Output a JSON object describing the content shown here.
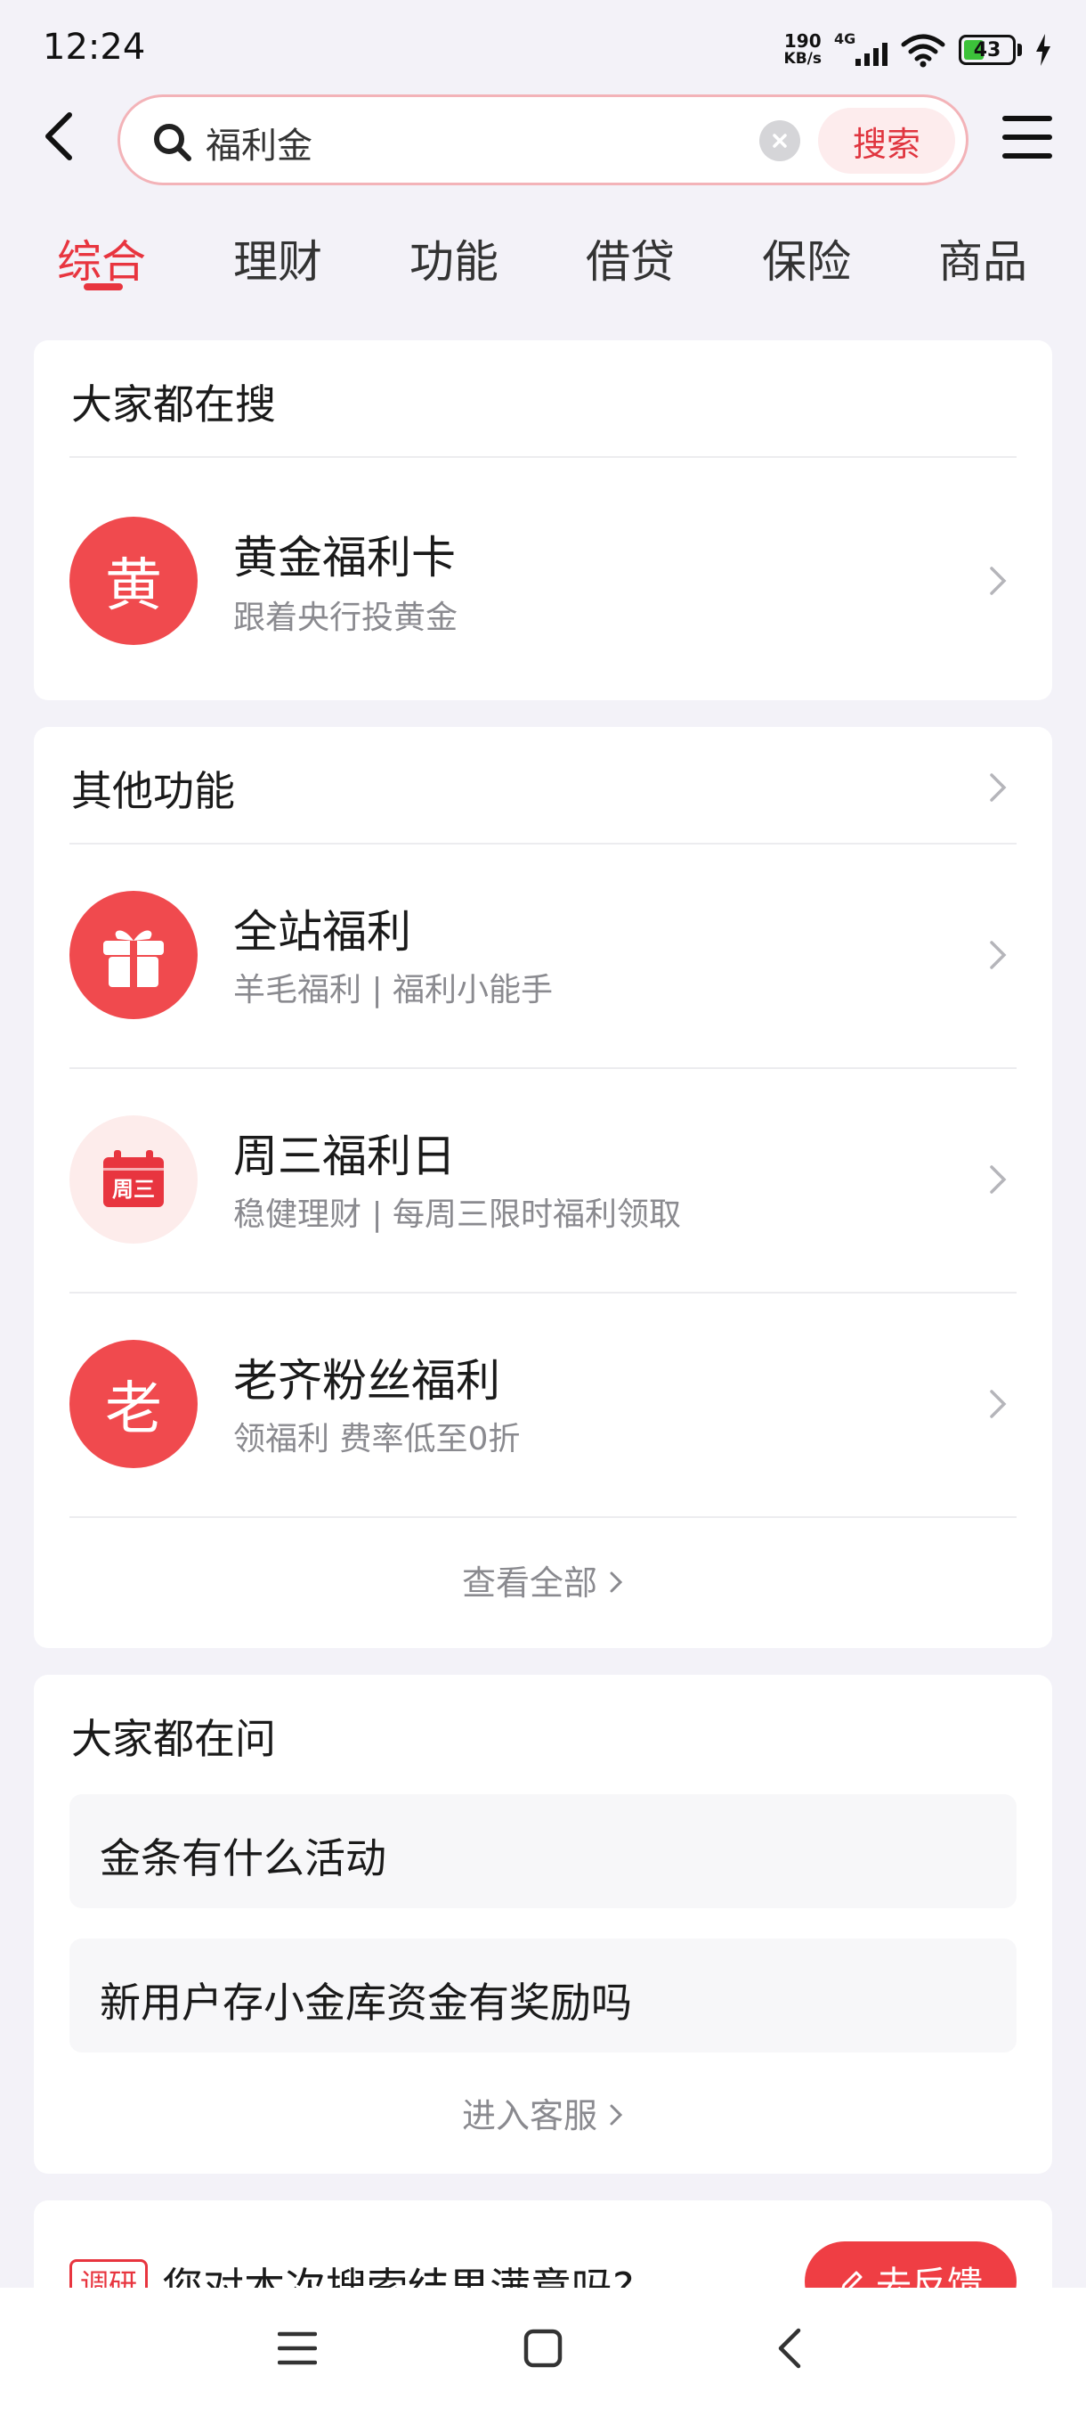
{
  "status": {
    "time": "12:24",
    "net_speed_value": "190",
    "net_speed_unit": "KB/s",
    "network": "4G",
    "battery": "43",
    "battery_level": 0.43
  },
  "search": {
    "query": "福利金",
    "button_label": "搜索"
  },
  "tabs": [
    "综合",
    "理财",
    "功能",
    "借贷",
    "保险",
    "商品"
  ],
  "popular": {
    "title": "大家都在搜",
    "item": {
      "icon_char": "黄",
      "title": "黄金福利卡",
      "subtitle": "跟着央行投黄金"
    }
  },
  "functions": {
    "title": "其他功能",
    "items": [
      {
        "icon": "gift-icon",
        "title": "全站福利",
        "subtitle": "羊毛福利 | 福利小能手"
      },
      {
        "icon": "calendar-icon",
        "icon_text": "周三",
        "title": "周三福利日",
        "subtitle": "稳健理财 | 每周三限时福利领取"
      },
      {
        "icon_char": "老",
        "title": "老齐粉丝福利",
        "subtitle": "领福利 费率低至0折"
      }
    ],
    "view_all": "查看全部"
  },
  "questions": {
    "title": "大家都在问",
    "items": [
      "金条有什么活动",
      "新用户存小金库资金有奖励吗"
    ],
    "service_link": "进入客服"
  },
  "survey": {
    "tag": "调研",
    "question": "您对本次搜索结果满意吗?",
    "button": "去反馈"
  },
  "colors": {
    "accent": "#e8353f",
    "background": "#f3f2f8"
  }
}
